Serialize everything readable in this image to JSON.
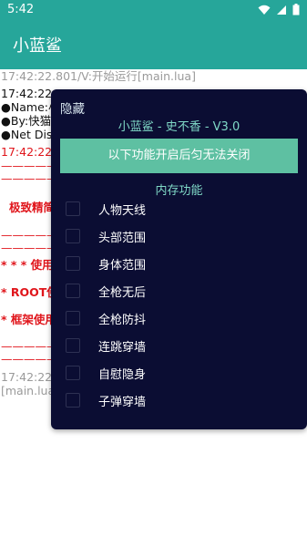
{
  "status_bar": {
    "time": "5:42"
  },
  "app_bar": {
    "title": "小蓝鲨"
  },
  "log": {
    "lines": [
      "17:42:22.801/V:开始运行[main.lua]",
      "17:42:22.",
      "●Name:小",
      "●By:快猫",
      "●Net Dis",
      "17:42:22.",
      "————————",
      "————————",
      "极致精简",
      "————————",
      "————————",
      "* * * 使用说",
      "* ROOT使",
      "* 框架使用",
      "————————",
      "————————",
      "17:42:22.",
      "[main.lua]"
    ]
  },
  "menu": {
    "hide_label": "隐藏",
    "title": "小蓝鲨 - 史不香 - V3.0",
    "banner": "以下功能开启后匀无法关闭",
    "section": "内存功能",
    "options": [
      "人物天线",
      "头部范围",
      "身体范围",
      "全枪无后",
      "全枪防抖",
      "连跳穿墙",
      "自慰隐身",
      "子弹穿墙"
    ]
  },
  "colors": {
    "accent": "#26a69a",
    "overlay_bg": "#0b0d33",
    "banner": "#5ec0a2",
    "log_red": "#e0151b"
  }
}
